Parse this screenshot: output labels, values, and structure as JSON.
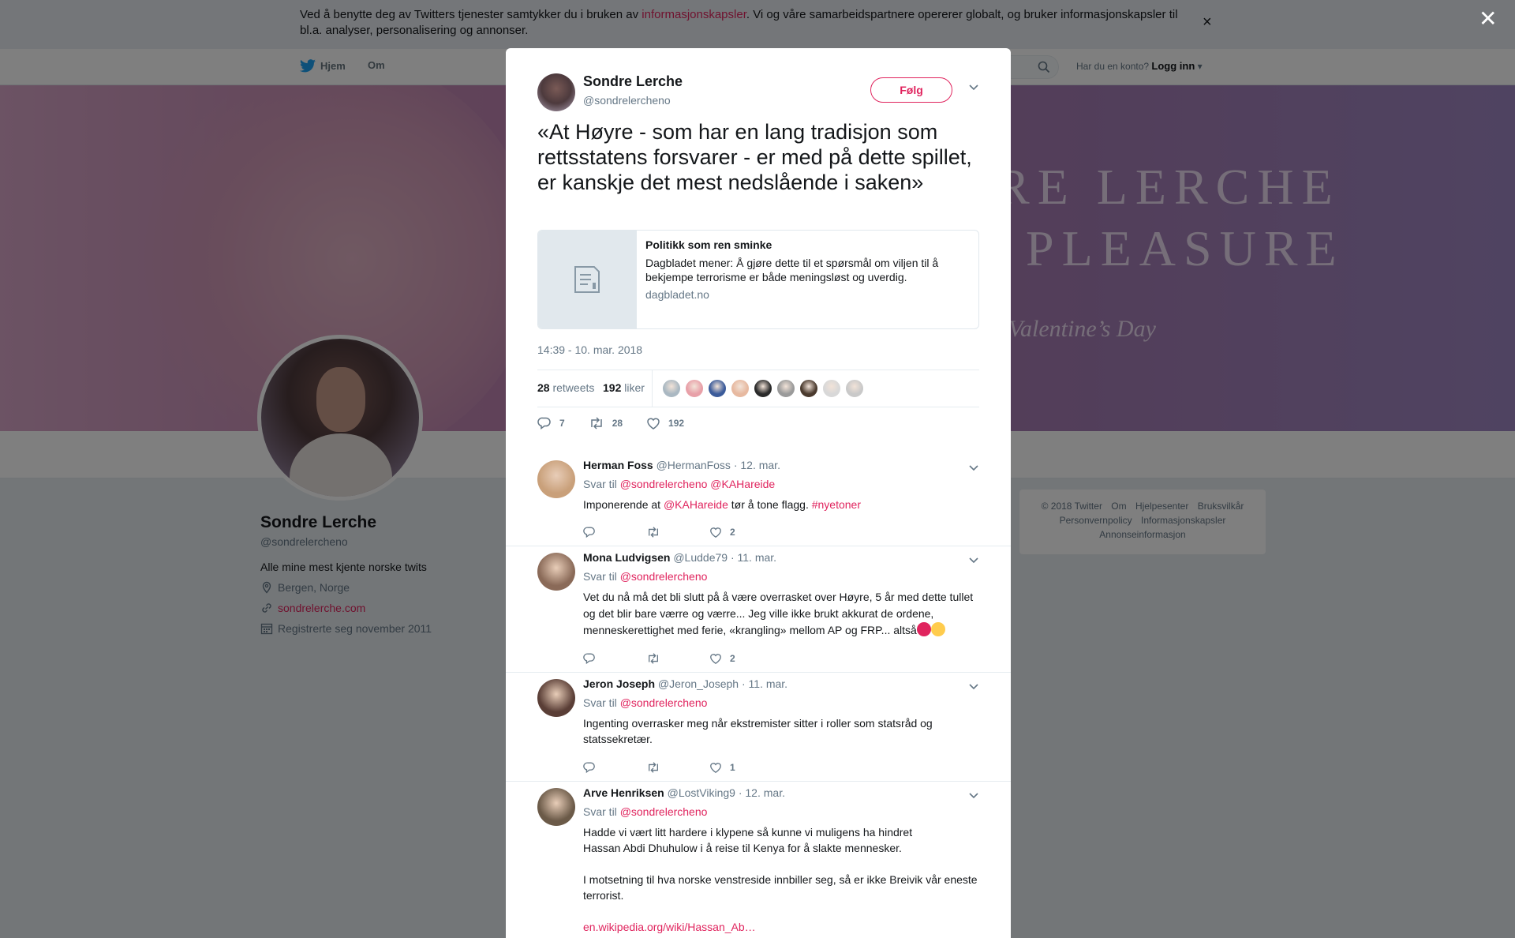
{
  "cookie_bar": {
    "text_before": "Ved å benytte deg av Twitters tjenester samtykker du i bruken av ",
    "link": "informasjonskapsler",
    "text_after": ". Vi og våre samarbeidspartnere opererer globalt, og bruker informasjonskapsler til bl.a. analyser, personalisering og annonser.",
    "close": "×"
  },
  "nav": {
    "home": "Hjem",
    "about": "Om",
    "account_prompt": "Har du en konto?",
    "login": "Logg inn"
  },
  "banner": {
    "line1": "RE LERCHE",
    "line2": "PLEASURE",
    "line3": "Valentine’s Day"
  },
  "profile": {
    "name": "Sondre Lerche",
    "handle": "@sondrelercheno",
    "bio": "Alle mine mest kjente norske twits",
    "location": "Bergen, Norge",
    "website": "sondrelerche.com",
    "joined": "Registrerte seg november 2011"
  },
  "footer": {
    "links": [
      "© 2018 Twitter",
      "Om",
      "Hjelpesenter",
      "Bruksvilkår",
      "Personvernpolicy",
      "Informasjonskapsler",
      "Annonseinformasjon"
    ]
  },
  "overlay_close": "✕",
  "tweet": {
    "name": "Sondre Lerche",
    "handle": "@sondrelercheno",
    "follow": "Følg",
    "text": "«At Høyre - som har en lang tradisjon som rettsstatens forsvarer - er med på dette spillet, er kanskje det mest nedslående i saken»",
    "card": {
      "title": "Politikk som ren sminke",
      "description": "Dagbladet mener: Å gjøre dette til et spørsmål om viljen til å bekjempe terrorisme er både meningsløst og uverdig.",
      "domain": "dagbladet.no"
    },
    "timestamp": "14:39 - 10. mar. 2018",
    "retweets_count": "28",
    "retweets_label": "retweets",
    "likes_count": "192",
    "likes_label": "liker",
    "actions": {
      "replies": "7",
      "retweets": "28",
      "likes": "192"
    }
  },
  "replies": [
    {
      "name": "Herman Foss",
      "handle": "@HermanFoss",
      "date": "· 12. mar.",
      "reply_label": "Svar til",
      "mentions": "@sondrelercheno @KAHareide",
      "body_pre": "Imponerende at ",
      "body_mention": "@KAHareide",
      "body_mid": " tør å tone flagg. ",
      "body_tag": "#nyetoner",
      "likes": "2",
      "avatar_color": "#c9a07a"
    },
    {
      "name": "Mona Ludvigsen",
      "handle": "@Ludde79",
      "date": "· 11. mar.",
      "reply_label": "Svar til",
      "mentions": "@sondrelercheno",
      "body": "Vet du nå må det bli slutt på å være overrasket over Høyre, 5 år med dette tullet og det blir bare værre og værre... Jeg ville ikke brukt akkurat de ordene, menneskerettighet med ferie, «krangling» mellom AP og FRP... altså",
      "likes": "2",
      "avatar_color": "#8a6a58"
    },
    {
      "name": "Jeron Joseph",
      "handle": "@Jeron_Joseph",
      "date": "· 11. mar.",
      "reply_label": "Svar til",
      "mentions": "@sondrelercheno",
      "body": "Ingenting overrasker meg når ekstremister sitter i roller som statsråd og statssekretær.",
      "likes": "1",
      "avatar_color": "#5a3e36"
    },
    {
      "name": "Arve Henriksen",
      "handle": "@LostViking9",
      "date": "· 12. mar.",
      "reply_label": "Svar til",
      "mentions": "@sondrelercheno",
      "body_p1": "Hadde vi vært litt hardere i klypene så kunne vi muligens ha hindret Hassan Abdi Dhuhulow i å reise til Kenya for å slakte mennesker.",
      "body_p2": "I motsetning til hva norske venstreside innbiller seg, så er ikke Breivik vår eneste terrorist.",
      "link": "en.wikipedia.org/wiki/Hassan_Ab…",
      "avatar_color": "#6b5a48"
    }
  ],
  "liker_avatar_colors": [
    "#aab8c2",
    "#e8a0a8",
    "#3b5b9a",
    "#e7b9a0",
    "#2a2a2a",
    "#9a9a9a",
    "#4a3a2e",
    "#d8d8d8",
    "#c9c9c9"
  ]
}
